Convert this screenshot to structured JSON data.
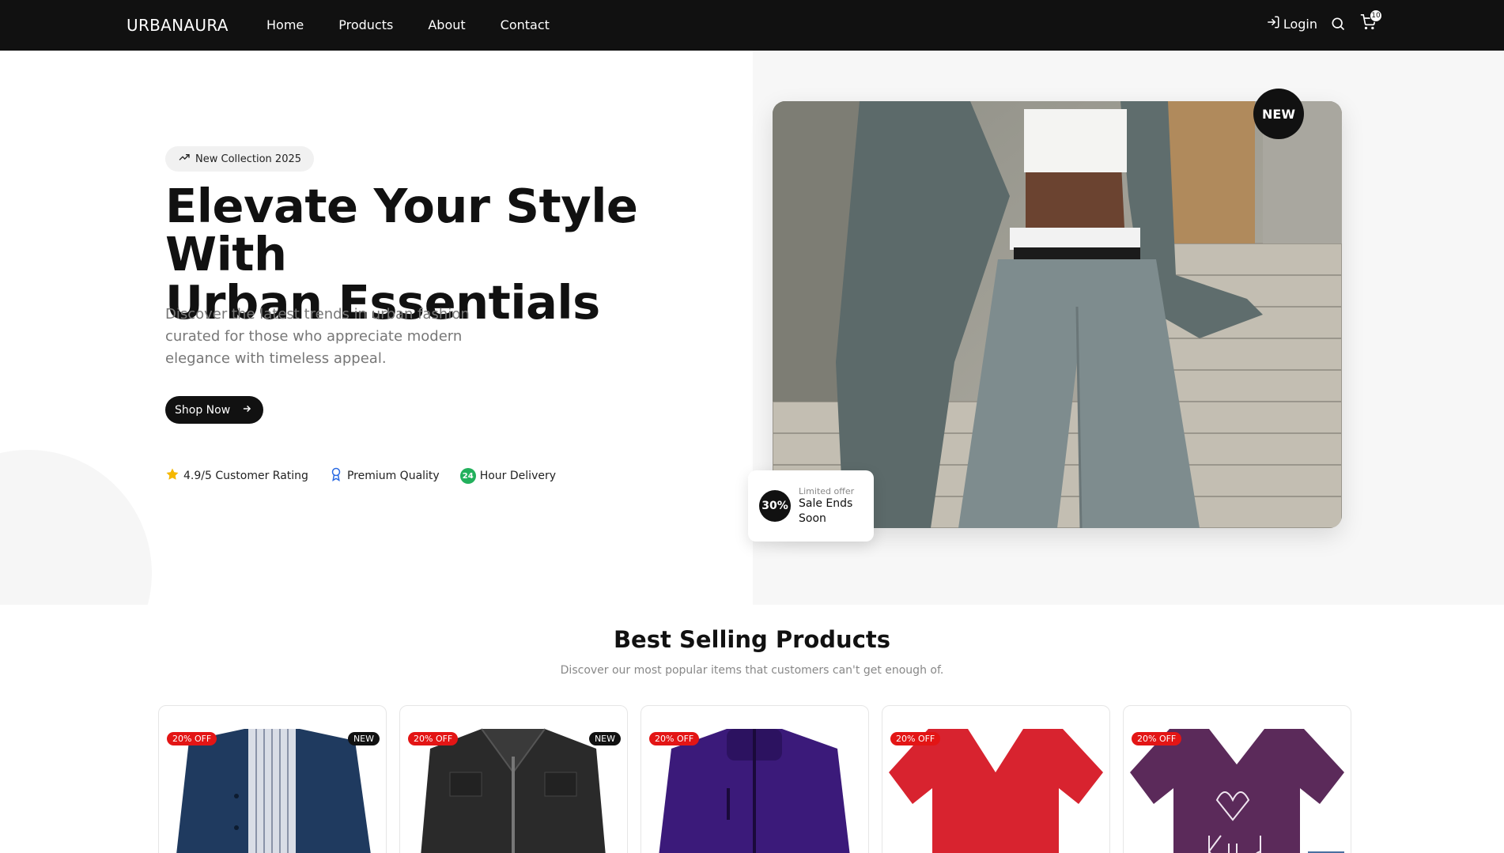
{
  "nav": {
    "brand": "URBANAURA",
    "links": [
      "Home",
      "Products",
      "About",
      "Contact"
    ],
    "login": "Login",
    "cart_count": "10"
  },
  "hero": {
    "pill": "New Collection 2025",
    "title_line1": "Elevate Your Style With",
    "title_line2": "Urban Essentials",
    "subtitle": "Discover the latest trends in urban fashion curated for those who appreciate modern elegance with timeless appeal.",
    "shop_button": "Shop Now",
    "features": [
      {
        "icon": "star-icon",
        "label": "4.9/5 Customer Rating"
      },
      {
        "icon": "award-ribbon-icon",
        "label": "Premium Quality"
      },
      {
        "icon": "24",
        "label": "Hour Delivery"
      }
    ],
    "new_badge": "NEW",
    "offer": {
      "percent": "30%",
      "small": "Limited offer",
      "text": "Sale Ends Soon"
    }
  },
  "best_selling": {
    "title": "Best Selling Products",
    "subtitle": "Discover our most popular items that customers can't get enough of.",
    "products": [
      {
        "discount": "20% OFF",
        "tag": "NEW",
        "color": "#1f3a5f"
      },
      {
        "discount": "20% OFF",
        "tag": "NEW",
        "color": "#2a2a2a"
      },
      {
        "discount": "20% OFF",
        "tag": "",
        "color": "#3b1a7a"
      },
      {
        "discount": "20% OFF",
        "tag": "",
        "color": "#d8232f"
      },
      {
        "discount": "20% OFF",
        "tag": "",
        "color": "#5b2a5a"
      }
    ]
  },
  "colors": {
    "nav_bg": "#111111",
    "accent_red": "#e31515",
    "delivery_green": "#22b05c",
    "star_yellow": "#f5b700",
    "quality_blue": "#2b6be3"
  }
}
